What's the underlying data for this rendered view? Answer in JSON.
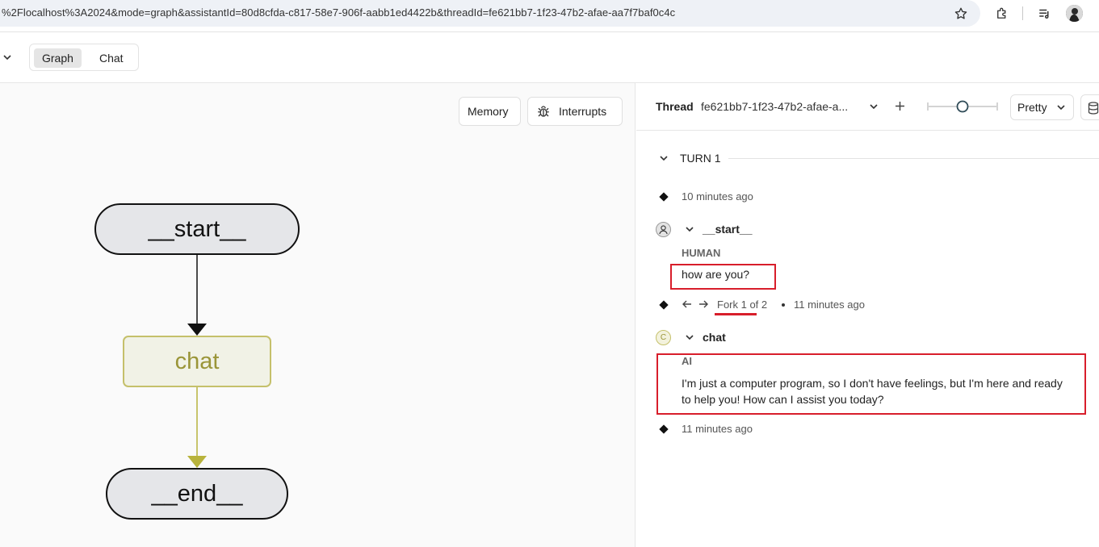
{
  "browser": {
    "url": "%2Flocalhost%3A2024&mode=graph&assistantId=80d8cfda-c817-58e7-906f-aabb1ed4422b&threadId=fe621bb7-1f23-47b2-afae-aa7f7baf0c4c"
  },
  "header": {
    "tabs": [
      "Graph",
      "Chat"
    ],
    "active_tab": "Graph"
  },
  "graph": {
    "memory_label": "Memory",
    "interrupts_label": "Interrupts",
    "nodes": [
      "__start__",
      "chat",
      "__end__"
    ],
    "colors": {
      "chat_border": "#c5c06b",
      "chat_fill": "#f1f2e6",
      "chat_text": "#9a9538",
      "terminal_fill": "#e5e6e9"
    }
  },
  "thread": {
    "label": "Thread",
    "id_short": "fe621bb7-1f23-47b2-afae-a...",
    "view_mode": "Pretty",
    "turn_label": "TURN 1",
    "checkpoint_1_time": "10 minutes ago",
    "start_node": "__start__",
    "human_role": "HUMAN",
    "human_message": "how are you?",
    "fork_label": "Fork 1 of 2",
    "fork_time": "11 minutes ago",
    "chat_node": "chat",
    "chat_avatar_letter": "C",
    "ai_role": "AI",
    "ai_message": "I'm just a computer program, so I don't have feelings, but I'm here and ready to help you! How can I assist you today?",
    "end_time": "11 minutes ago"
  }
}
